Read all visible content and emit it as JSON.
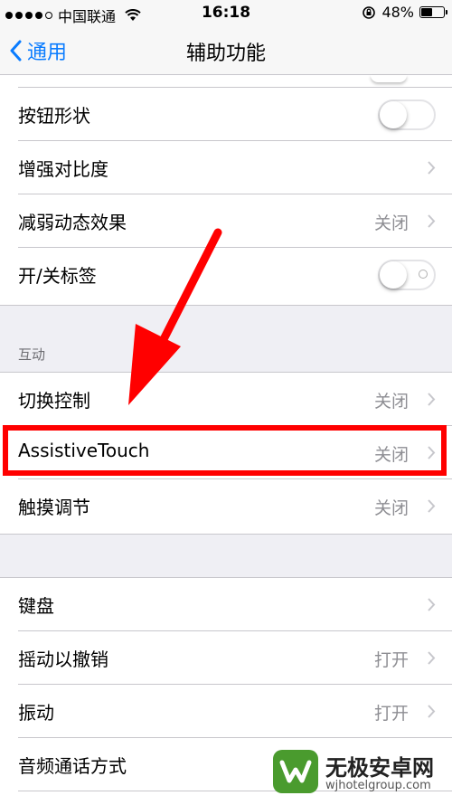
{
  "status_bar": {
    "carrier": "中国联通",
    "time": "16:18",
    "battery_text": "48%",
    "battery_level": 0.48
  },
  "nav": {
    "back_label": "通用",
    "title": "辅助功能"
  },
  "rows_top": [
    {
      "label": "按钮形状",
      "control": "toggle",
      "state": "off"
    },
    {
      "label": "增强对比度",
      "control": "chevron"
    },
    {
      "label": "减弱动态效果",
      "value": "关闭",
      "control": "chevron"
    },
    {
      "label": "开/关标签",
      "control": "toggle",
      "state": "off"
    }
  ],
  "section_interaction": {
    "header": "互动",
    "rows": [
      {
        "label": "切换控制",
        "value": "关闭"
      },
      {
        "label": "AssistiveTouch",
        "value": "关闭"
      },
      {
        "label": "触摸调节",
        "value": "关闭"
      }
    ]
  },
  "rows_bottom": [
    {
      "label": "键盘",
      "value": ""
    },
    {
      "label": "摇动以撤销",
      "value": "打开"
    },
    {
      "label": "振动",
      "value": "打开"
    },
    {
      "label": "音频通话方式",
      "value": ""
    }
  ],
  "annotation": {
    "highlight_color": "#ff0000",
    "arrow_color": "#ff0000"
  },
  "watermark": {
    "title": "无极安卓网",
    "subtitle": "wjhotelgroup.com"
  },
  "colors": {
    "accent": "#0a7cff",
    "background": "#efeff4",
    "secondary_text": "#8e8e93"
  }
}
